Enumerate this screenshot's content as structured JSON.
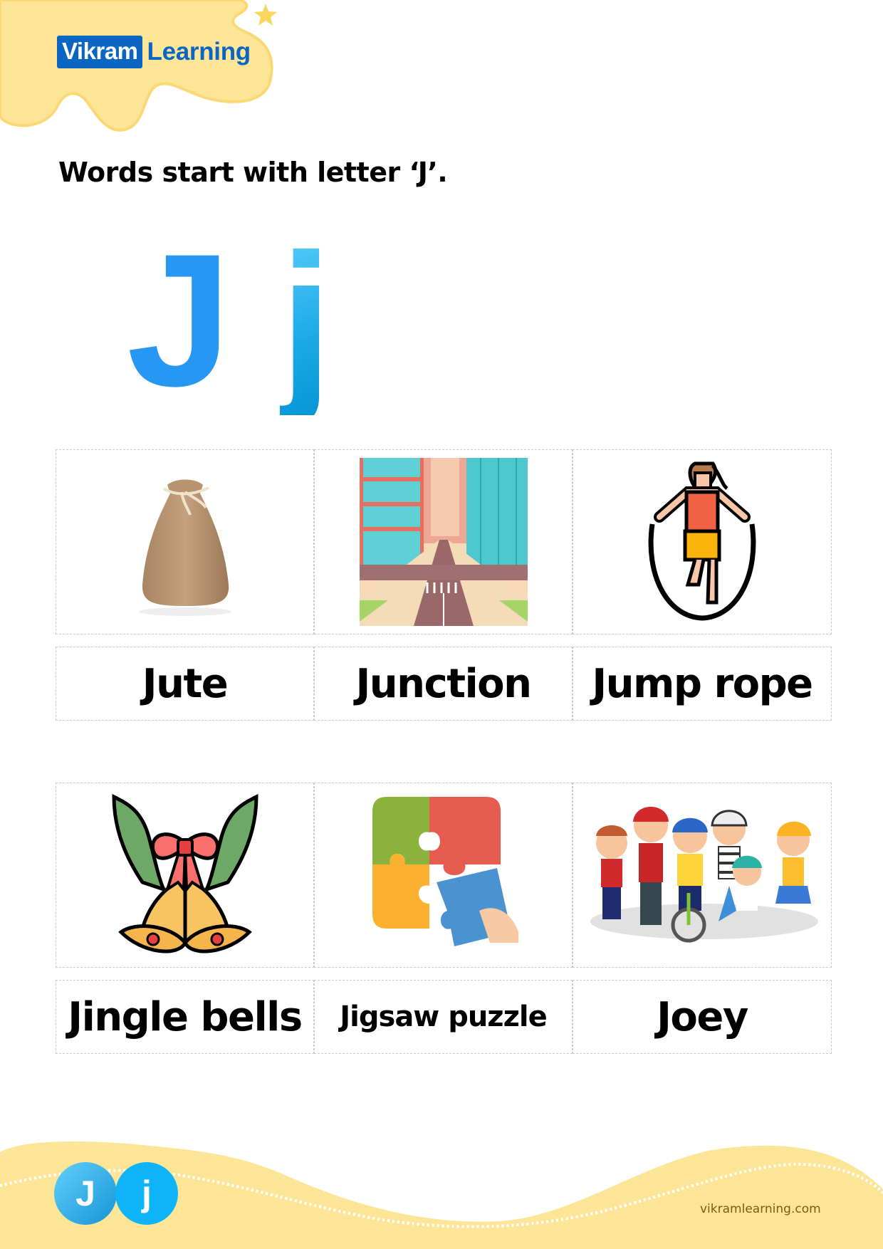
{
  "brand": {
    "name_part1": "Vikram",
    "name_part2": "Learning",
    "primary_color": "#0b66c3",
    "accent_yellow": "#fde597"
  },
  "worksheet": {
    "title": "Words start with letter ‘J’.",
    "letter_upper": "J",
    "letter_lower": "j",
    "letter_upper_color": "#2697f2",
    "letter_lower_color": "#1ba9e6"
  },
  "grids": [
    {
      "items": [
        {
          "word": "Jute",
          "icon": "jute-sack-icon"
        },
        {
          "word": "Junction",
          "icon": "city-junction-icon"
        },
        {
          "word": "Jump rope",
          "icon": "jump-rope-icon"
        }
      ]
    },
    {
      "items": [
        {
          "word": "Jingle bells",
          "icon": "jingle-bells-icon"
        },
        {
          "word": "Jigsaw puzzle",
          "icon": "jigsaw-puzzle-icon"
        },
        {
          "word": "Joey",
          "icon": "kids-group-icon"
        }
      ]
    }
  ],
  "footer": {
    "badge_upper": "J",
    "badge_lower": "j",
    "website": "vikramlearning.com"
  }
}
